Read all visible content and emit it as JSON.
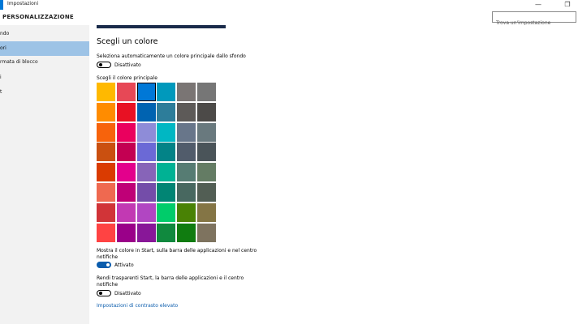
{
  "window": {
    "title": "Impostazioni",
    "minimize": "—",
    "restore": "❐"
  },
  "header": {
    "title": "PERSONALIZZAZIONE"
  },
  "search": {
    "placeholder": "Trova un'impostazione"
  },
  "sidebar": {
    "items": [
      {
        "label": "ndo",
        "active": false
      },
      {
        "label": "ori",
        "active": true
      },
      {
        "label": "rmata di blocco",
        "active": false
      },
      {
        "label": "i",
        "active": false
      },
      {
        "label": "t",
        "active": false
      }
    ]
  },
  "colors_page": {
    "title": "Scegli un colore",
    "auto_color_label": "Seleziona automaticamente un colore principale dallo sfondo",
    "auto_color_state": "Disattivato",
    "palette_label": "Scegli il colore principale",
    "show_color_label_line1": "Mostra il colore in Start, sulla barra delle applicazioni e nel centro",
    "show_color_label_line2": "notifiche",
    "show_color_state": "Attivato",
    "transparency_label_line1": "Rendi trasparenti Start, la barra delle applicazioni e il centro",
    "transparency_label_line2": "notifiche",
    "transparency_state": "Disattivato",
    "high_contrast_link": "Impostazioni di contrasto elevato"
  },
  "palette": {
    "columns": 6,
    "selected_index": 2,
    "colors": [
      "#ffb900",
      "#e74856",
      "#0078d7",
      "#0099bc",
      "#7a7574",
      "#767676",
      "#ff8c00",
      "#e81123",
      "#0063b1",
      "#2d7d9a",
      "#5d5a58",
      "#4c4a48",
      "#f7630c",
      "#ea005e",
      "#8e8cd8",
      "#00b7c3",
      "#68768a",
      "#69797e",
      "#ca5010",
      "#c30052",
      "#6b69d6",
      "#038387",
      "#515c6b",
      "#4a5459",
      "#da3b01",
      "#e3008c",
      "#8764b8",
      "#00b294",
      "#567c73",
      "#647c64",
      "#ef6950",
      "#bf0077",
      "#744da9",
      "#018574",
      "#486860",
      "#525e54",
      "#d13438",
      "#c239b3",
      "#b146c2",
      "#00cc6a",
      "#498205",
      "#847545",
      "#ff4343",
      "#9a0089",
      "#881798",
      "#10893e",
      "#107c10",
      "#7e735f"
    ]
  }
}
